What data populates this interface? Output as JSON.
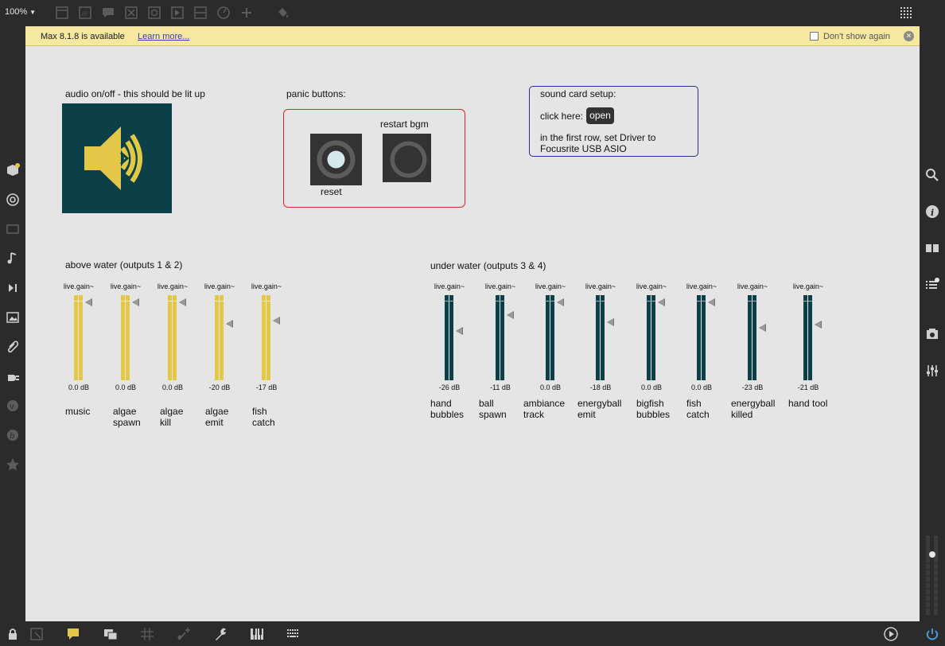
{
  "toolbar": {
    "zoom": "100%"
  },
  "banner": {
    "message": "Max 8.1.8 is available",
    "link": "Learn more...",
    "dont_show": "Don't show again"
  },
  "labels": {
    "audio": "audio on/off  - this should be lit up",
    "panic": "panic buttons:",
    "restart": "restart bgm",
    "reset": "reset",
    "soundcard": "sound card setup:",
    "click_here": "click here:",
    "open": "open",
    "instructions_1": "in the first row, set Driver to",
    "instructions_2": "Focusrite USB ASIO",
    "above": "above water (outputs 1 & 2)",
    "under": "under water (outputs 3 & 4)"
  },
  "colors": {
    "above_bar": "#e3c848",
    "under_bar": "#0b4049",
    "banner": "#f6e7a1",
    "audio_bg": "#0b4049",
    "audio_icon": "#e3c848"
  },
  "above_water": [
    {
      "object": "live.gain~",
      "value": "0.0 dB",
      "label": [
        "music"
      ],
      "level": 0.92
    },
    {
      "object": "live.gain~",
      "value": "0.0 dB",
      "label": [
        "algae",
        "spawn"
      ],
      "level": 0.92
    },
    {
      "object": "live.gain~",
      "value": "0.0 dB",
      "label": [
        "algae",
        "kill"
      ],
      "level": 0.92
    },
    {
      "object": "live.gain~",
      "value": "-20 dB",
      "label": [
        "algae",
        "emit"
      ],
      "level": 0.66
    },
    {
      "object": "live.gain~",
      "value": "-17 dB",
      "label": [
        "fish",
        "catch"
      ],
      "level": 0.7
    }
  ],
  "under_water": [
    {
      "object": "live.gain~",
      "value": "-26 dB",
      "label": [
        "hand",
        "bubbles"
      ],
      "level": 0.58
    },
    {
      "object": "live.gain~",
      "value": "-11 dB",
      "label": [
        "ball",
        "spawn"
      ],
      "level": 0.77
    },
    {
      "object": "live.gain~",
      "value": "0.0 dB",
      "label": [
        "ambiance",
        "track"
      ],
      "level": 0.92
    },
    {
      "object": "live.gain~",
      "value": "-18 dB",
      "label": [
        "energyball",
        "emit"
      ],
      "level": 0.68
    },
    {
      "object": "live.gain~",
      "value": "0.0 dB",
      "label": [
        "bigfish",
        "bubbles"
      ],
      "level": 0.92
    },
    {
      "object": "live.gain~",
      "value": "0.0 dB",
      "label": [
        "fish",
        "catch"
      ],
      "level": 0.92
    },
    {
      "object": "live.gain~",
      "value": "-23 dB",
      "label": [
        "energyball",
        "killed"
      ],
      "level": 0.62
    },
    {
      "object": "live.gain~",
      "value": "-21 dB",
      "label": [
        "hand tool"
      ],
      "level": 0.65
    }
  ]
}
